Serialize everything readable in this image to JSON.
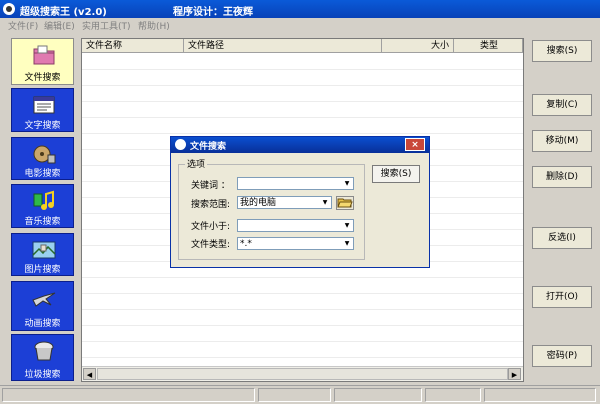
{
  "window": {
    "title": "超级搜索王 (v2.0)",
    "designer": "程序设计：王夜辉"
  },
  "menu": [
    "文件(F)",
    "编辑(E)",
    "实用工具(T)",
    "帮助(H)"
  ],
  "nav": [
    {
      "label": "文件搜索",
      "icon": "folder-icon",
      "active": true
    },
    {
      "label": "文字搜索",
      "icon": "text-icon"
    },
    {
      "label": "电影搜索",
      "icon": "movie-icon"
    },
    {
      "label": "音乐搜索",
      "icon": "music-icon"
    },
    {
      "label": "图片搜索",
      "icon": "picture-icon"
    },
    {
      "label": "动画搜索",
      "icon": "animation-icon"
    },
    {
      "label": "垃圾搜索",
      "icon": "trash-icon"
    }
  ],
  "list": {
    "columns": [
      "文件名称",
      "文件路径",
      "大小",
      "类型"
    ]
  },
  "actions": [
    "搜索(S)",
    "复制(C)",
    "移动(M)",
    "删除(D)",
    "反选(I)",
    "打开(O)",
    "密码(P)"
  ],
  "dialog": {
    "title": "文件搜索",
    "close": "×",
    "group_title": "选项",
    "keyword_label": "关键词 ：",
    "keyword_value": "",
    "scope_label": "搜索范围:",
    "scope_value": "我的电脑",
    "size_label": "文件小于:",
    "size_value": "",
    "type_label": "文件类型:",
    "type_value": "*.*",
    "search_button": "搜索(S)"
  },
  "colors": {
    "title_bar": "#0a5ad8",
    "nav_blue": "#1c3fd6",
    "nav_active": "#ffffc0",
    "dialog_close": "#c9483a"
  }
}
